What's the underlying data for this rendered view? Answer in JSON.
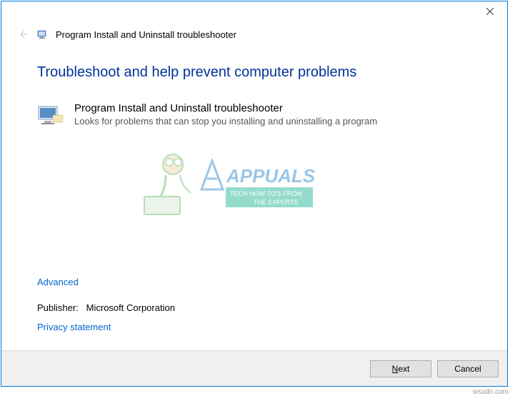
{
  "header": {
    "title": "Program Install and Uninstall troubleshooter"
  },
  "main": {
    "heading": "Troubleshoot and help prevent computer problems",
    "troubleshooter_name": "Program Install and Uninstall troubleshooter",
    "troubleshooter_desc": "Looks for problems that can stop you installing and uninstalling a program"
  },
  "links": {
    "advanced": "Advanced",
    "privacy": "Privacy statement"
  },
  "publisher": {
    "label": "Publisher:",
    "value": "Microsoft Corporation"
  },
  "buttons": {
    "next_prefix": "N",
    "next_suffix": "ext",
    "cancel": "Cancel"
  },
  "watermark": {
    "brand": "APPUALS",
    "tagline1": "TECH HOW-TO'S FROM",
    "tagline2": "THE EXPERTS"
  },
  "source": "wsxdn.com"
}
